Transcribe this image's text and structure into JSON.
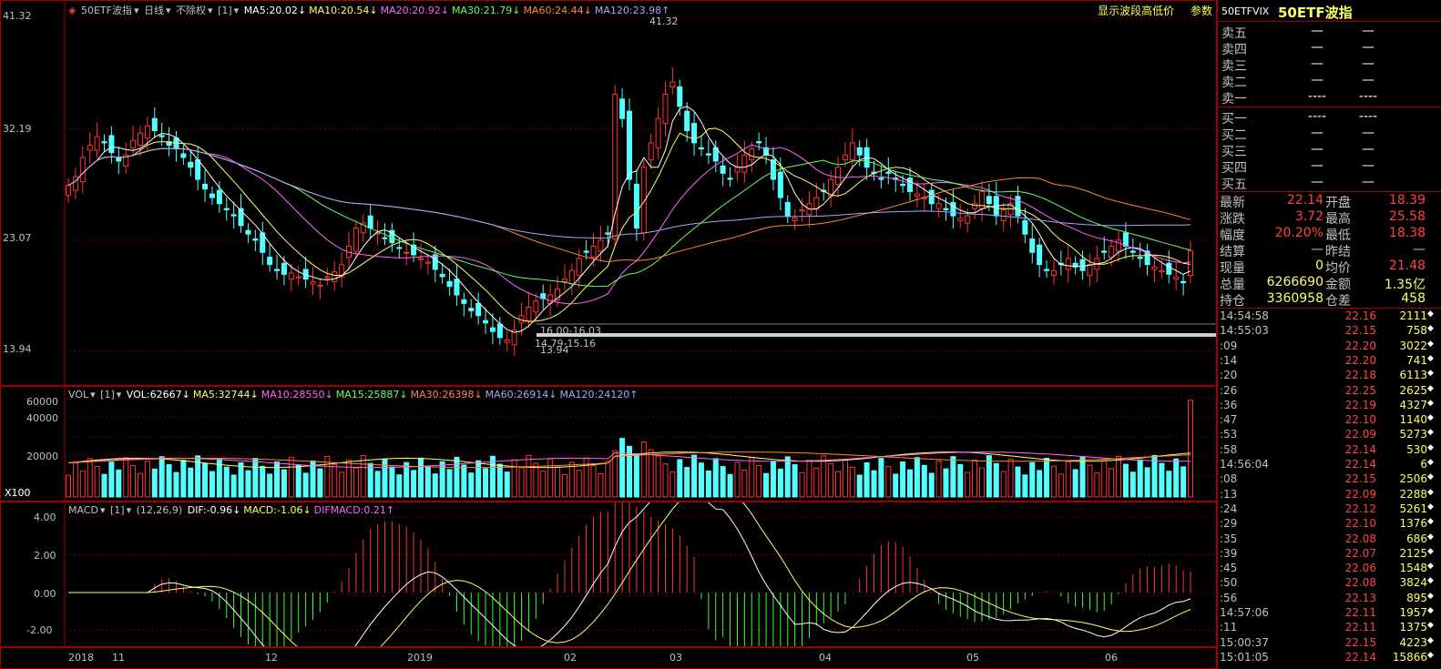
{
  "header": {
    "symbol_name": "50ETF波指",
    "period": "日线",
    "adjust": "不除权",
    "ma_items": [
      {
        "label": "MA5:20.02",
        "color": "#ffffff"
      },
      {
        "label": "MA10:20.54",
        "color": "#ffff66"
      },
      {
        "label": "MA20:20.92",
        "color": "#ff66ff"
      },
      {
        "label": "MA30:21.79",
        "color": "#66ff66"
      },
      {
        "label": "MA60:24.44",
        "color": "#ff8833"
      },
      {
        "label": "MA120:23.98",
        "color": "#a6a6ff"
      }
    ],
    "bracket": "[1]",
    "right_link": "显示波段高低价",
    "params_label": "参数"
  },
  "price_axis": {
    "labels": [
      "41.32",
      "32.19",
      "23.07",
      "13.94"
    ]
  },
  "price_annotations": {
    "high": "41.32",
    "low": "13.94",
    "band1": "16.00-16.03",
    "band2": "14.79-15.16"
  },
  "volume": {
    "title": "VOL",
    "bracket": "[1]",
    "items": [
      {
        "label": "VOL:62667",
        "color": "#ffffff"
      },
      {
        "label": "MA5:32744",
        "color": "#ffff66"
      },
      {
        "label": "MA10:28550",
        "color": "#ff66ff"
      },
      {
        "label": "MA15:25887",
        "color": "#66ff66"
      },
      {
        "label": "MA30:26398",
        "color": "#ff8833"
      },
      {
        "label": "MA60:26914",
        "color": "#a6a6ff"
      },
      {
        "label": "MA120:24120",
        "color": "#a6a6ff"
      }
    ],
    "axis": [
      "60000",
      "40000",
      "20000"
    ],
    "multiplier": "X100"
  },
  "macd": {
    "title": "MACD",
    "bracket": "[1]",
    "params": "(12,26,9)",
    "items": [
      {
        "label": "DIF:-0.96",
        "color": "#ffffff"
      },
      {
        "label": "MACD:-1.06",
        "color": "#ffff66"
      },
      {
        "label": "DIFMACD:0.21",
        "color": "#ff66ff"
      }
    ],
    "axis": [
      "4.00",
      "2.00",
      "0.00",
      "-2.00"
    ]
  },
  "dates": [
    "2018",
    "11",
    "12",
    "2019",
    "02",
    "03",
    "04",
    "05",
    "06"
  ],
  "side": {
    "code": "50ETFVIX",
    "name": "50ETF波指",
    "asks": [
      {
        "label": "卖五",
        "p": "—",
        "v": "—"
      },
      {
        "label": "卖四",
        "p": "—",
        "v": "—"
      },
      {
        "label": "卖三",
        "p": "—",
        "v": "—"
      },
      {
        "label": "卖二",
        "p": "—",
        "v": "—"
      },
      {
        "label": "卖一",
        "p": "----",
        "v": "----"
      }
    ],
    "bids": [
      {
        "label": "买一",
        "p": "----",
        "v": "----"
      },
      {
        "label": "买二",
        "p": "—",
        "v": "—"
      },
      {
        "label": "买三",
        "p": "—",
        "v": "—"
      },
      {
        "label": "买四",
        "p": "—",
        "v": "—"
      },
      {
        "label": "买五",
        "p": "—",
        "v": "—"
      }
    ],
    "stats": [
      {
        "k1": "最新",
        "v1": "22.14",
        "c1": "#ff4444",
        "k2": "开盘",
        "v2": "18.39",
        "c2": "#ff4444"
      },
      {
        "k1": "涨跌",
        "v1": "3.72",
        "c1": "#ff4444",
        "k2": "最高",
        "v2": "25.58",
        "c2": "#ff4444"
      },
      {
        "k1": "幅度",
        "v1": "20.20%",
        "c1": "#ff4444",
        "k2": "最低",
        "v2": "18.38",
        "c2": "#ff4444"
      },
      {
        "k1": "结算",
        "v1": "—",
        "c1": "#c0c0c0",
        "k2": "昨结",
        "v2": "—",
        "c2": "#c0c0c0"
      },
      {
        "k1": "现量",
        "v1": "0",
        "c1": "#ffff66",
        "k2": "均价",
        "v2": "21.48",
        "c2": "#ff4444"
      },
      {
        "k1": "总量",
        "v1": "6266690",
        "c1": "#ffff66",
        "k2": "金额",
        "v2": "1.35亿",
        "c2": "#ffff66"
      },
      {
        "k1": "持仓",
        "v1": "3360958",
        "c1": "#ffff66",
        "k2": "仓差",
        "v2": "458",
        "c2": "#ffff66"
      }
    ],
    "ticks": [
      {
        "t": "14:54:58",
        "p": "22.16",
        "v": "2111"
      },
      {
        "t": "14:55:03",
        "p": "22.15",
        "v": "758"
      },
      {
        "t": ":09",
        "p": "22.20",
        "v": "3022"
      },
      {
        "t": ":14",
        "p": "22.20",
        "v": "741"
      },
      {
        "t": ":20",
        "p": "22.18",
        "v": "6113"
      },
      {
        "t": ":26",
        "p": "22.25",
        "v": "2625"
      },
      {
        "t": ":36",
        "p": "22.19",
        "v": "4327"
      },
      {
        "t": ":47",
        "p": "22.10",
        "v": "1140"
      },
      {
        "t": ":53",
        "p": "22.09",
        "v": "5273"
      },
      {
        "t": ":58",
        "p": "22.14",
        "v": "530"
      },
      {
        "t": "14:56:04",
        "p": "22.14",
        "v": "6"
      },
      {
        "t": ":08",
        "p": "22.15",
        "v": "2506"
      },
      {
        "t": ":13",
        "p": "22.09",
        "v": "2288"
      },
      {
        "t": ":24",
        "p": "22.12",
        "v": "5261"
      },
      {
        "t": ":29",
        "p": "22.10",
        "v": "1376"
      },
      {
        "t": ":35",
        "p": "22.08",
        "v": "686"
      },
      {
        "t": ":39",
        "p": "22.07",
        "v": "2125"
      },
      {
        "t": ":45",
        "p": "22.06",
        "v": "1548"
      },
      {
        "t": ":50",
        "p": "22.08",
        "v": "3824"
      },
      {
        "t": ":56",
        "p": "22.13",
        "v": "895"
      },
      {
        "t": "14:57:06",
        "p": "22.11",
        "v": "1957"
      },
      {
        "t": ":11",
        "p": "22.11",
        "v": "1375"
      },
      {
        "t": "15:00:37",
        "p": "22.15",
        "v": "4223"
      },
      {
        "t": "15:01:05",
        "p": "22.14",
        "v": "15866"
      }
    ]
  },
  "colors": {
    "up": "#ff3333",
    "down": "#54ffff",
    "grid": "#a00000"
  },
  "chart_data": {
    "type": "candlestick",
    "title": "50ETF波指 日线",
    "ylim": [
      13.94,
      41.32
    ],
    "x": [
      "2018",
      "11",
      "12",
      "2019",
      "02",
      "03",
      "04",
      "05",
      "06"
    ],
    "closes": [
      27.5,
      28.2,
      29.8,
      30.8,
      31.5,
      31.0,
      30.2,
      29.5,
      30.0,
      31.2,
      31.8,
      32.4,
      32.0,
      31.5,
      30.8,
      30.5,
      29.8,
      29.0,
      28.0,
      27.2,
      26.5,
      26.0,
      25.5,
      25.0,
      24.2,
      23.5,
      23.0,
      22.0,
      21.0,
      20.5,
      20.2,
      20.3,
      20.0,
      19.8,
      19.6,
      19.3,
      20.0,
      20.4,
      21.0,
      22.5,
      24.0,
      24.4,
      24.0,
      23.6,
      23.2,
      22.8,
      22.4,
      22.0,
      21.8,
      21.5,
      21.2,
      20.6,
      20.0,
      19.2,
      18.5,
      17.8,
      17.2,
      16.8,
      16.2,
      15.5,
      15.0,
      14.8,
      15.6,
      16.8,
      17.5,
      18.0,
      18.2,
      18.5,
      19.0,
      19.8,
      20.5,
      21.5,
      22.0,
      22.5,
      23.0,
      23.5,
      35.0,
      33.0,
      28.0,
      24.0,
      29.0,
      31.0,
      33.0,
      35.0,
      36.0,
      34.0,
      32.0,
      31.0,
      30.5,
      30.0,
      29.5,
      28.5,
      28.0,
      29.0,
      30.0,
      30.5,
      31.0,
      30.0,
      28.0,
      26.5,
      25.0,
      24.8,
      25.5,
      26.0,
      26.5,
      27.0,
      28.0,
      29.0,
      30.0,
      31.0,
      30.0,
      29.0,
      28.5,
      28.0,
      28.5,
      28.0,
      27.5,
      27.0,
      26.8,
      26.5,
      26.0,
      26.0,
      25.5,
      25.0,
      24.8,
      25.0,
      26.0,
      27.0,
      26.0,
      25.0,
      25.5,
      26.0,
      25.0,
      23.5,
      22.0,
      21.0,
      20.5,
      20.5,
      21.0,
      21.5,
      20.8,
      20.5,
      21.0,
      21.5,
      22.0,
      22.5,
      23.0,
      22.5,
      22.0,
      21.5,
      21.0,
      20.8,
      20.5,
      20.2,
      20.0,
      19.5,
      22.14
    ],
    "volume": [
      62667
    ],
    "macd": {
      "dif": -0.96,
      "dea": -1.06,
      "hist": 0.21
    }
  }
}
